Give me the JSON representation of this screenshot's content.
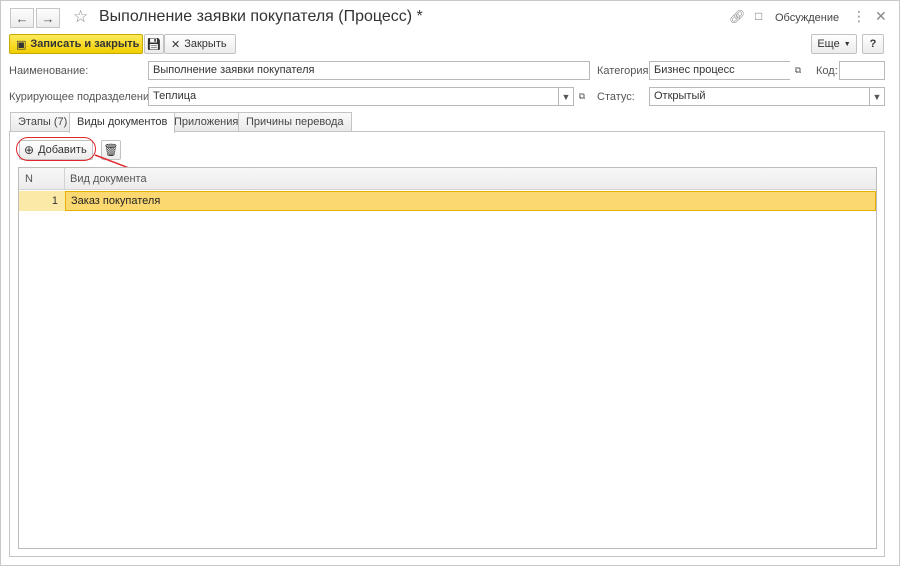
{
  "window": {
    "title": "Выполнение заявки покупателя (Процесс) *",
    "discussion_label": "Обсуждение",
    "icons": [
      "back-arrow-icon",
      "forward-arrow-icon",
      "star-icon",
      "link-icon",
      "discussion-icon",
      "more-icon",
      "close-icon"
    ]
  },
  "toolbar": {
    "save_close_label": "Записать и закрыть",
    "close_label": "Закрыть",
    "more_label": "Еще",
    "help_label": "?"
  },
  "form": {
    "name_label": "Наименование:",
    "name_value": "Выполнение заявки покупателя",
    "category_label": "Категория:",
    "category_value": "Бизнес процесс",
    "code_label": "Код:",
    "code_value": "",
    "department_label": "Курирующее подразделение:",
    "department_value": "Теплица",
    "status_label": "Статус:",
    "status_value": "Открытый"
  },
  "tabs": [
    {
      "label": "Этапы (7)"
    },
    {
      "label": "Виды документов"
    },
    {
      "label": "Приложения"
    },
    {
      "label": "Причины перевода"
    }
  ],
  "doc_types": {
    "add_label": "Добавить",
    "columns": {
      "n": "N",
      "doc_type": "Вид документа"
    },
    "rows": [
      {
        "n": "1",
        "doc_type": "Заказ покупателя"
      }
    ]
  },
  "colors": {
    "primary_button": "#f5d21c",
    "selected_row": "#fbd970",
    "annotation": "#e0262b"
  }
}
